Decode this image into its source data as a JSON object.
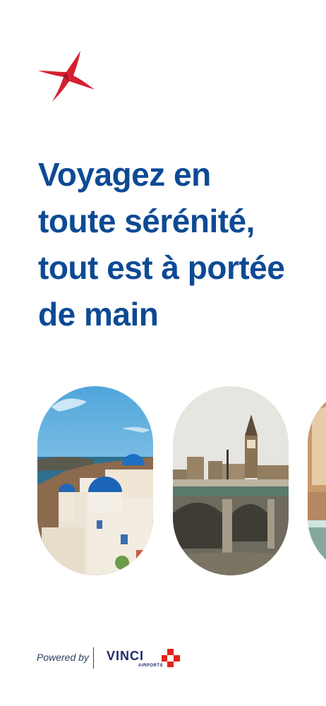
{
  "headline": {
    "lines": [
      "Voyagez en",
      "toute sérénité,",
      "tout est à portée",
      "de main"
    ]
  },
  "gallery": {
    "items": [
      {
        "icon": "santorini-photo"
      },
      {
        "icon": "london-big-ben-photo"
      },
      {
        "icon": "moroccan-architecture-photo"
      }
    ]
  },
  "footer": {
    "powered_by": "Powered by",
    "brand": "VINCI",
    "brand_sub": "AIRPORTS"
  },
  "colors": {
    "headline": "#0d4a94",
    "logo_red": "#d5202f",
    "brand_navy": "#1f2a6b",
    "brand_red": "#e2231a"
  }
}
